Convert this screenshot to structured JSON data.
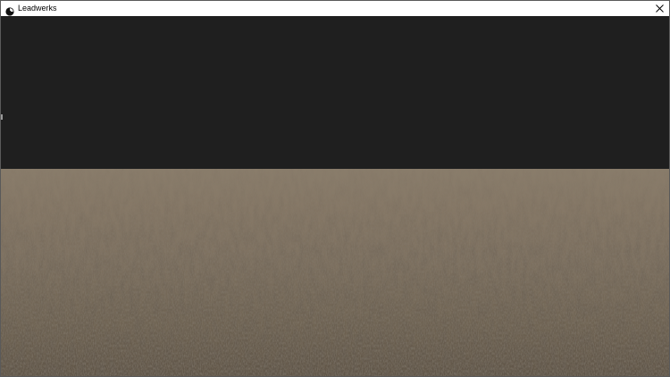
{
  "window": {
    "title": "Leadwerks",
    "app_icon": "leadwerks-logo-icon",
    "close_icon": "close-icon"
  },
  "scene": {
    "sky_color": "#1f1f1f",
    "ground_color": "#867866"
  }
}
